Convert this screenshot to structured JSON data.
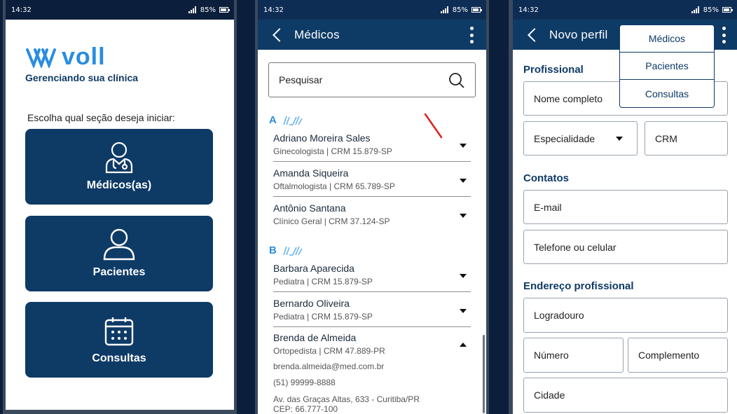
{
  "status": {
    "time": "14:32",
    "battery": "85%"
  },
  "home": {
    "logo_text": "voll",
    "tagline": "Gerenciando sua clínica",
    "prompt": "Escolha qual seção deseja iniciar:",
    "buttons": [
      {
        "label": "Médicos(as)",
        "icon": "doctor-icon"
      },
      {
        "label": "Pacientes",
        "icon": "person-icon"
      },
      {
        "label": "Consultas",
        "icon": "calendar-icon"
      }
    ]
  },
  "medicos": {
    "title": "Médicos",
    "search_placeholder": "Pesquisar",
    "groups": [
      {
        "letter": "A",
        "items": [
          {
            "name": "Adriano Moreira Sales",
            "sub": "Ginecologista | CRM 15.879-SP"
          },
          {
            "name": "Amanda Siqueira",
            "sub": "Oftalmologista | CRM 65.789-SP"
          },
          {
            "name": "Antônio Santana",
            "sub": "Clínico Geral | CRM 37.124-SP"
          }
        ]
      },
      {
        "letter": "B",
        "items": [
          {
            "name": "Barbara Aparecida",
            "sub": "Pediatra | CRM 15.879-SP"
          },
          {
            "name": "Bernardo Oliveira",
            "sub": "Pediatra | CRM 15.879-SP"
          },
          {
            "name": "Brenda de Almeida",
            "sub": "Ortopedista | CRM 47.889-PR",
            "email": "brenda.almeida@med.com.br",
            "phone": "(51) 99999-8888",
            "address": "Av. das Graças Altas, 633 - Curitiba/PR",
            "cep": "CEP: 66.777-100"
          }
        ]
      }
    ]
  },
  "novo_perfil": {
    "title": "Novo perfil",
    "menu": [
      "Médicos",
      "Pacientes",
      "Consultas"
    ],
    "sections": {
      "profissional": "Profissional",
      "contatos": "Contatos",
      "endereco": "Endereço profissional"
    },
    "fields": {
      "nome": "Nome completo",
      "especialidade": "Especialidade",
      "crm": "CRM",
      "email": "E-mail",
      "telefone": "Telefone ou celular",
      "logradouro": "Logradouro",
      "numero": "Número",
      "complemento": "Complemento",
      "cidade": "Cidade"
    }
  }
}
